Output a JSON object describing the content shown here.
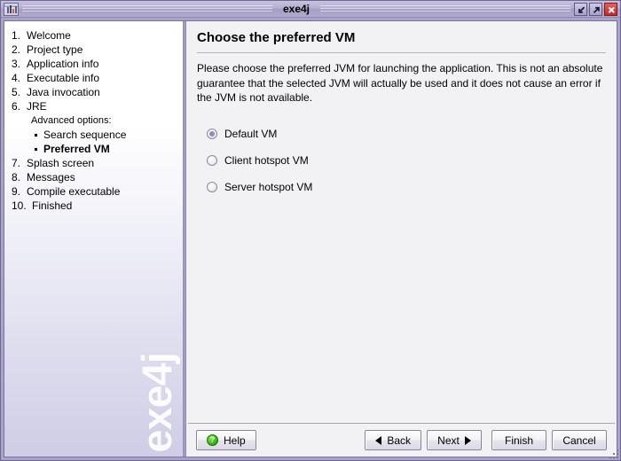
{
  "window": {
    "title": "exe4j",
    "app_icon": "application-window-icon",
    "controls": [
      {
        "name": "minimize-button",
        "icon": "arrow-down-left-icon",
        "label": "Minimize"
      },
      {
        "name": "maximize-button",
        "icon": "arrow-up-right-icon",
        "label": "Maximize"
      },
      {
        "name": "close-button",
        "icon": "close-x-icon",
        "label": "Close"
      }
    ]
  },
  "sidebar": {
    "watermark": "exe4j",
    "steps": [
      {
        "num": "1.",
        "label": "Welcome",
        "active": false
      },
      {
        "num": "2.",
        "label": "Project type",
        "active": false
      },
      {
        "num": "3.",
        "label": "Application info",
        "active": false
      },
      {
        "num": "4.",
        "label": "Executable info",
        "active": false
      },
      {
        "num": "5.",
        "label": "Java invocation",
        "active": false
      },
      {
        "num": "6.",
        "label": "JRE",
        "active": false
      }
    ],
    "advanced_heading": "Advanced options:",
    "sub_items": [
      {
        "label": "Search sequence",
        "active": false
      },
      {
        "label": "Preferred VM",
        "active": true
      }
    ],
    "steps_after": [
      {
        "num": "7.",
        "label": "Splash screen",
        "active": false
      },
      {
        "num": "8.",
        "label": "Messages",
        "active": false
      },
      {
        "num": "9.",
        "label": "Compile executable",
        "active": false
      },
      {
        "num": "10.",
        "label": "Finished",
        "active": false
      }
    ]
  },
  "main": {
    "title": "Choose the preferred VM",
    "description": "Please choose the preferred JVM for launching the application. This is not an absolute guarantee that the selected JVM will actually be used and it does not cause an error if the JVM is not available.",
    "options": [
      {
        "label": "Default VM",
        "selected": true
      },
      {
        "label": "Client hotspot VM",
        "selected": false
      },
      {
        "label": "Server hotspot VM",
        "selected": false
      }
    ]
  },
  "buttons": {
    "help": "Help",
    "back": "Back",
    "next": "Next",
    "finish": "Finish",
    "cancel": "Cancel",
    "help_icon": "help-question-icon",
    "back_icon": "triangle-left-icon",
    "next_icon": "triangle-right-icon"
  },
  "colors": {
    "frame": "#a9a3c8",
    "titlebar": "#b4afd0",
    "close_red": "#c32a24",
    "panel_bg": "#f2f1f4",
    "radio_dot": "#8f8cc0",
    "help_green": "#3dbf17"
  }
}
